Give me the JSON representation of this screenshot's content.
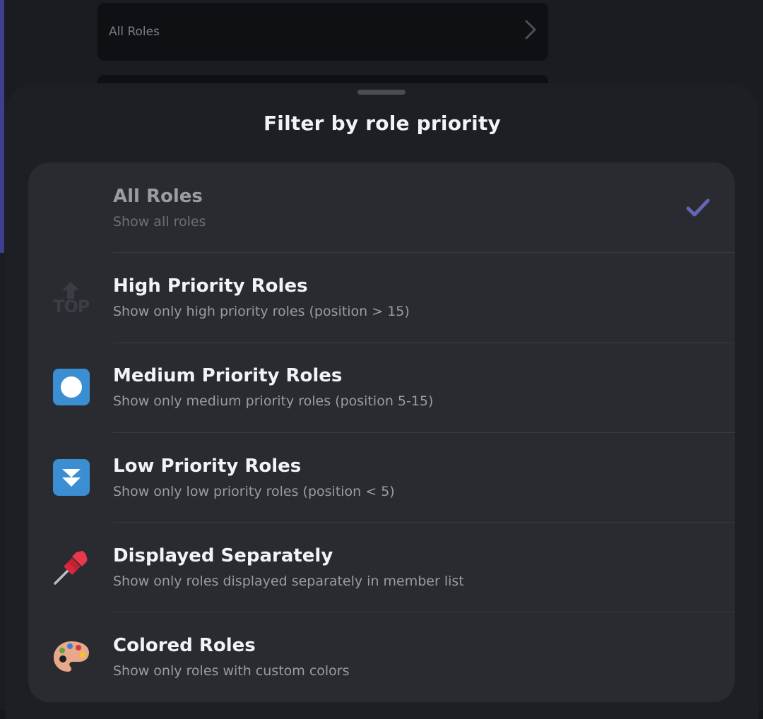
{
  "background": {
    "row_label": "All Roles"
  },
  "sheet": {
    "title": "Filter by role priority"
  },
  "options": [
    {
      "title": "All Roles",
      "subtitle": "Show all roles",
      "icon": "none",
      "selected": true
    },
    {
      "title": "High Priority Roles",
      "subtitle": "Show only high priority roles (position > 15)",
      "icon": "top-arrow-icon",
      "selected": false
    },
    {
      "title": "Medium Priority Roles",
      "subtitle": "Show only medium priority roles (position 5-15)",
      "icon": "record-button-icon",
      "selected": false
    },
    {
      "title": "Low Priority Roles",
      "subtitle": "Show only low priority roles (position < 5)",
      "icon": "fast-down-button-icon",
      "selected": false
    },
    {
      "title": "Displayed Separately",
      "subtitle": "Show only roles displayed separately in member list",
      "icon": "pushpin-icon",
      "selected": false
    },
    {
      "title": "Colored Roles",
      "subtitle": "Show only roles with custom colors",
      "icon": "artist-palette-icon",
      "selected": false
    }
  ],
  "colors": {
    "check": "#6466b5",
    "icon_blue": "#3b8ed1",
    "sheet_bg": "#1e1f24",
    "card_bg": "#2a2b31"
  }
}
